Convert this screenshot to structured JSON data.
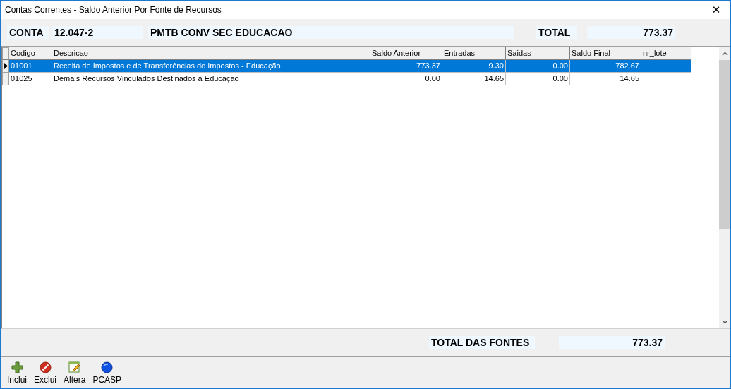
{
  "window": {
    "title": "Contas Correntes - Saldo Anterior Por Fonte de Recursos",
    "close": "✕"
  },
  "header": {
    "conta_label": "CONTA",
    "conta_value": "12.047-2",
    "conta_name": "PMTB CONV SEC EDUCACAO",
    "total_label": "TOTAL",
    "total_value": "773.37"
  },
  "table": {
    "columns": [
      "Codigo",
      "Descricao",
      "Saldo Anterior",
      "Entradas",
      "Saidas",
      "Saldo Final",
      "nr_lote"
    ],
    "rows": [
      {
        "selected": true,
        "cells": [
          "01001",
          "Receita de Impostos e de Transferências de Impostos - Educação",
          "773.37",
          "9.30",
          "0.00",
          "782.67",
          ""
        ]
      },
      {
        "selected": false,
        "cells": [
          "01025",
          "Demais Recursos Vinculados Destinados à Educação",
          "0.00",
          "14.65",
          "0.00",
          "14.65",
          ""
        ]
      }
    ]
  },
  "footer": {
    "total_label": "TOTAL DAS FONTES",
    "total_value": "773.37"
  },
  "toolbar": [
    {
      "kind": "add",
      "label": "Inclui"
    },
    {
      "kind": "delete",
      "label": "Exclui"
    },
    {
      "kind": "edit",
      "label": "Altera"
    },
    {
      "kind": "globe",
      "label": "PCASP"
    }
  ]
}
